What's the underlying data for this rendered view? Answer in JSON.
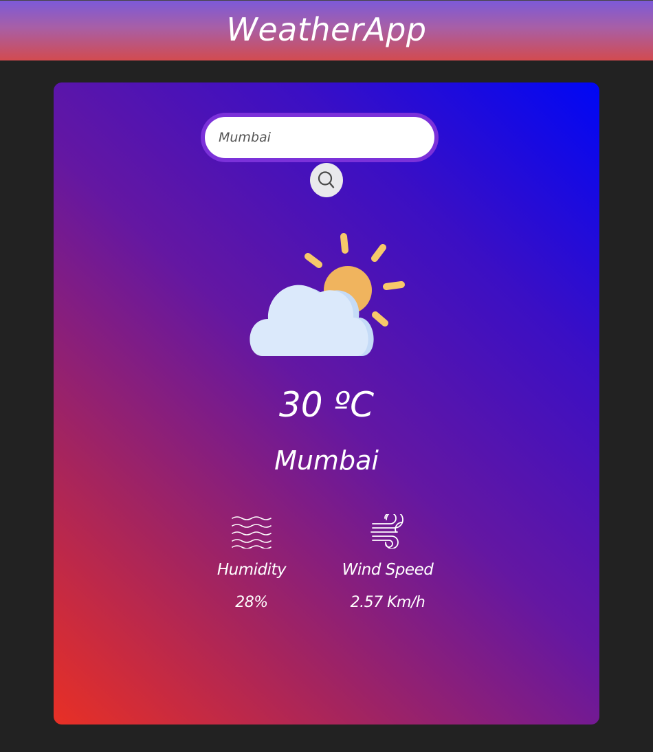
{
  "app": {
    "title": "WeatherApp"
  },
  "search": {
    "value": "",
    "placeholder": "Mumbai",
    "button_icon": "search-icon"
  },
  "weather": {
    "icon": "partly-cloudy-icon",
    "temperature": "30 ºC",
    "city": "Mumbai"
  },
  "stats": {
    "humidity": {
      "icon": "humidity-waves-icon",
      "label": "Humidity",
      "value": "28%"
    },
    "wind": {
      "icon": "wind-icon",
      "label": "Wind Speed",
      "value": "2.57 Km/h"
    }
  },
  "colors": {
    "background": "#222222",
    "header_top": "#7c5ad8",
    "header_bottom": "#d24b4f",
    "card_gradient_start": "#0007f5",
    "card_gradient_end": "#e83025",
    "search_ring": "#7b31d9",
    "sun": "#f0b45e",
    "sun_rays": "#f7c96a",
    "cloud": "#dbe9fb"
  }
}
